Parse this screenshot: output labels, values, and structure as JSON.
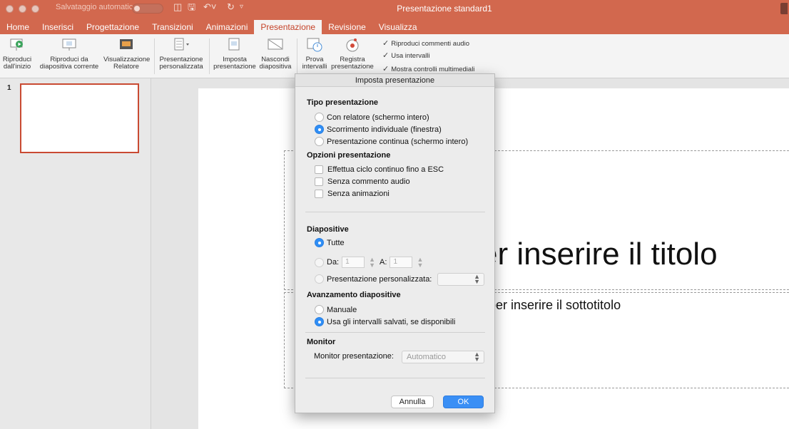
{
  "titlebar": {
    "autosave_label": "Salvataggio automatico",
    "autosave_state": "off",
    "doc_title": "Presentazione standard1"
  },
  "tabs": [
    {
      "label": "Home"
    },
    {
      "label": "Inserisci"
    },
    {
      "label": "Progettazione"
    },
    {
      "label": "Transizioni"
    },
    {
      "label": "Animazioni"
    },
    {
      "label": "Presentazione",
      "active": true
    },
    {
      "label": "Revisione"
    },
    {
      "label": "Visualizza"
    }
  ],
  "ribbon": {
    "play_start": [
      "Riproduci",
      "dall'inizio"
    ],
    "play_current": [
      "Riproduci da",
      "diapositiva corrente"
    ],
    "presenter_view": [
      "Visualizzazione",
      "Relatore"
    ],
    "custom_show": [
      "Presentazione",
      "personalizzata"
    ],
    "setup_show": [
      "Imposta",
      "presentazione"
    ],
    "hide_slide": [
      "Nascondi",
      "diapositiva"
    ],
    "rehearse": [
      "Prova",
      "intervalli"
    ],
    "record": [
      "Registra",
      "presentazione"
    ],
    "checks": [
      "Riproduci commenti audio",
      "Usa intervalli",
      "Mostra controlli multimediali"
    ]
  },
  "thumbnails": {
    "slide_number": "1"
  },
  "slide": {
    "title_fragment": "er inserire il titolo",
    "subtitle_fragment": "per inserire il sottotitolo"
  },
  "dialog": {
    "title": "Imposta presentazione",
    "show_type": {
      "heading": "Tipo presentazione",
      "options": [
        "Con relatore (schermo intero)",
        "Scorrimento individuale (finestra)",
        "Presentazione continua (schermo intero)"
      ],
      "selected": "Scorrimento individuale (finestra)"
    },
    "show_options": {
      "heading": "Opzioni presentazione",
      "options": [
        "Effettua ciclo continuo fino a ESC",
        "Senza commento audio",
        "Senza animazioni"
      ]
    },
    "slides": {
      "heading": "Diapositive",
      "all": "Tutte",
      "from_label": "Da:",
      "from_value": "1",
      "to_label": "A:",
      "to_value": "1",
      "custom_label": "Presentazione personalizzata:",
      "selected": "Tutte"
    },
    "advance": {
      "heading": "Avanzamento diapositive",
      "options": [
        "Manuale",
        "Usa gli intervalli salvati, se disponibili"
      ],
      "selected": "Usa gli intervalli salvati, se disponibili"
    },
    "monitor": {
      "heading": "Monitor",
      "label": "Monitor presentazione:",
      "value": "Automatico"
    },
    "cancel_label": "Annulla",
    "ok_label": "OK"
  },
  "colors": {
    "accent": "#d2684e",
    "active_tab_text": "#c5432a",
    "radio_selected": "#2f8ef5"
  }
}
